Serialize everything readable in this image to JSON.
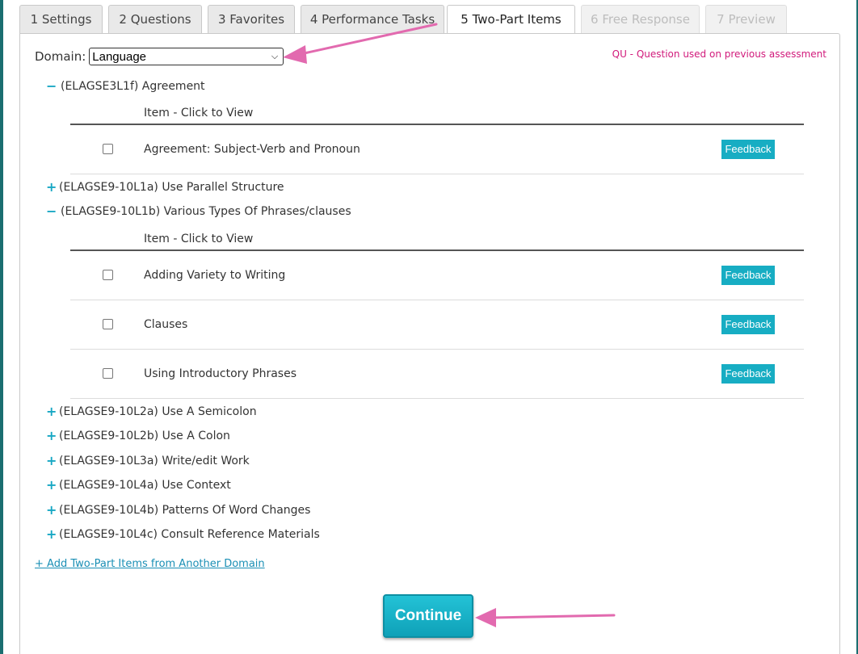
{
  "tabs": [
    {
      "label": "1 Settings",
      "state": "normal"
    },
    {
      "label": "2 Questions",
      "state": "normal"
    },
    {
      "label": "3 Favorites",
      "state": "normal"
    },
    {
      "label": "4 Performance Tasks",
      "state": "normal"
    },
    {
      "label": "5 Two-Part Items",
      "state": "active"
    },
    {
      "label": "6 Free Response",
      "state": "disabled"
    },
    {
      "label": "7 Preview",
      "state": "disabled"
    }
  ],
  "domain": {
    "label": "Domain:",
    "selected": "Language"
  },
  "legend": "QU - Question used on previous assessment",
  "table_header": "Item - Click to View",
  "feedback_label": "Feedback",
  "standards": [
    {
      "toggle": "−",
      "label": "(ELAGSE3L1f) Agreement",
      "items": [
        "Agreement: Subject-Verb and Pronoun"
      ]
    },
    {
      "toggle": "+",
      "label": "(ELAGSE9-10L1a) Use Parallel Structure"
    },
    {
      "toggle": "−",
      "label": "(ELAGSE9-10L1b) Various Types Of Phrases/clauses",
      "items": [
        "Adding Variety to Writing",
        "Clauses",
        "Using Introductory Phrases"
      ]
    },
    {
      "toggle": "+",
      "label": "(ELAGSE9-10L2a) Use A Semicolon"
    },
    {
      "toggle": "+",
      "label": "(ELAGSE9-10L2b) Use A Colon"
    },
    {
      "toggle": "+",
      "label": "(ELAGSE9-10L3a) Write/edit Work"
    },
    {
      "toggle": "+",
      "label": "(ELAGSE9-10L4a) Use Context"
    },
    {
      "toggle": "+",
      "label": "(ELAGSE9-10L4b) Patterns Of Word Changes"
    },
    {
      "toggle": "+",
      "label": "(ELAGSE9-10L4c) Consult Reference Materials"
    }
  ],
  "add_link": "+ Add Two-Part Items from Another Domain",
  "continue_label": "Continue",
  "colors": {
    "accent": "#17adc3",
    "legend": "#d11a7b",
    "arrow": "#e26aaf",
    "frame": "#1b6e70"
  }
}
